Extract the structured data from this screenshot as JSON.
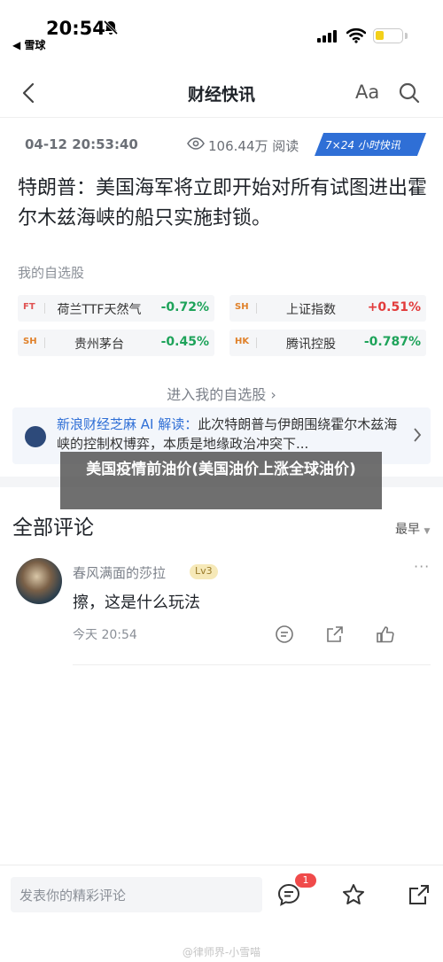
{
  "status_bar": {
    "time": "20:54",
    "back_app": "◀ 雪球"
  },
  "nav": {
    "title": "财经快讯",
    "font_size_label": "Aa"
  },
  "article": {
    "datetime": "04-12 20:53:40",
    "views": "106.44万 阅读",
    "badge": "7×24 小时快讯",
    "headline": "特朗普：美国海军将立即开始对所有试图进出霍尔木兹海峡的船只实施封锁。"
  },
  "watchlist": {
    "label": "我的自选股",
    "stocks": [
      {
        "exchange": "FT",
        "name": "荷兰TTF天然气",
        "change": "-0.72%",
        "direction": "down"
      },
      {
        "exchange": "SH",
        "name": "上证指数",
        "change": "+0.51%",
        "direction": "up"
      },
      {
        "exchange": "SH",
        "name": "贵州茅台",
        "change": "-0.45%",
        "direction": "down"
      },
      {
        "exchange": "HK",
        "name": "腾讯控股",
        "change": "-0.787%",
        "direction": "down"
      }
    ],
    "more": "进入我的自选股 ›"
  },
  "ai_summary": {
    "brand": "新浪财经芝麻 AI 解读：",
    "text": "此次特朗普与伊朗围绕霍尔木兹海峡的控制权博弈，本质是地缘政治冲突下..."
  },
  "overlay_title": "美国疫情前油价(美国油价上涨全球油价)",
  "comments": {
    "title": "全部评论",
    "sort": "最早",
    "items": [
      {
        "user": "春风满面的莎拉",
        "level": "Lv3",
        "text": "擦，这是什么玩法",
        "time": "今天 20:54"
      }
    ]
  },
  "bottom_bar": {
    "placeholder": "发表你的精彩评论",
    "comment_count": "1"
  },
  "watermark": "@律师界-小雪喵",
  "colors": {
    "up": "#e23b3b",
    "down": "#1ea35a",
    "accent": "#2f6fd6"
  }
}
